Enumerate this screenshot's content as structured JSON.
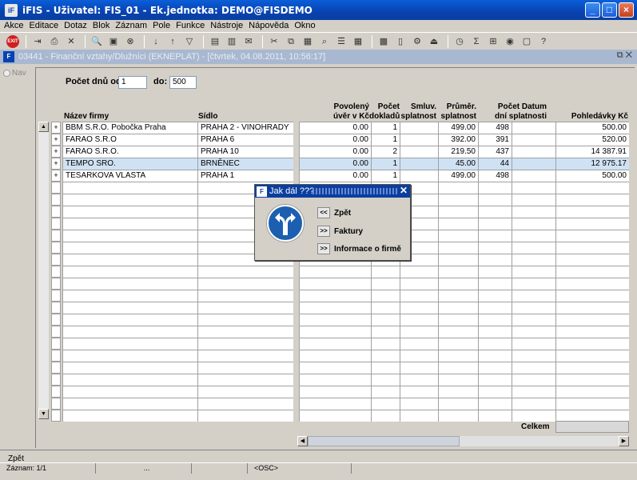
{
  "window": {
    "icon": "ifis-app-icon",
    "title": "iFIS - Uživatel: FIS_01 - Ek.jednotka: DEMO@FISDEMO"
  },
  "menu": [
    "Akce",
    "Editace",
    "Dotaz",
    "Blok",
    "Záznam",
    "Pole",
    "Funkce",
    "Nástroje",
    "Nápověda",
    "Okno"
  ],
  "inner_window": {
    "title": "03441 - Finanční vztahy/Dlužníci (EKNEPLAT) - [čtvrtek, 04.08.2011, 10:56:17]"
  },
  "sidebar": {
    "nav_label": "Nav"
  },
  "filter": {
    "days_from_label": "Počet dnů od:",
    "days_from_value": "1",
    "days_to_label": "do:",
    "days_to_value": "500"
  },
  "columns": {
    "company": "Název firmy",
    "seat": "Sídlo",
    "credit": "Povolený\núvěr v Kč",
    "docs": "Počet\ndokladů",
    "contract": "Smluv.\nsplatnost",
    "avg": "Průměr.\nsplatnost",
    "days": "Počet Datum\ndní splatnosti",
    "receivables": "Pohledávky Kč"
  },
  "rows": [
    {
      "company": "BBM S.R.O. Pobočka Praha",
      "seat": "PRAHA 2 - VINOHRADY",
      "credit": "0.00",
      "docs": "1",
      "contract": "",
      "avg": "499.00",
      "days": "498",
      "due": "",
      "receivables": "500.00"
    },
    {
      "company": "FARAO S.R.O",
      "seat": "PRAHA 6",
      "credit": "0.00",
      "docs": "1",
      "contract": "",
      "avg": "392.00",
      "days": "391",
      "due": "",
      "receivables": "520.00"
    },
    {
      "company": "FARAO S.R.O.",
      "seat": "PRAHA 10",
      "credit": "0.00",
      "docs": "2",
      "contract": "",
      "avg": "219.50",
      "days": "437",
      "due": "",
      "receivables": "14 387.91"
    },
    {
      "company": "TEMPO SRO.",
      "seat": "BRNĚNEC",
      "credit": "0.00",
      "docs": "1",
      "contract": "",
      "avg": "45.00",
      "days": "44",
      "due": "",
      "receivables": "12 975.17"
    },
    {
      "company": "TESARKOVA VLASTA",
      "seat": "PRAHA 1",
      "credit": "0.00",
      "docs": "1",
      "contract": "",
      "avg": "499.00",
      "days": "498",
      "due": "",
      "receivables": "500.00"
    }
  ],
  "total_label": "Celkem",
  "dialog": {
    "title": "Jak dál ???",
    "options": [
      "Zpět",
      "Faktury",
      "Informace o firmě"
    ],
    "buttons": [
      "<<",
      ">>",
      ">>"
    ]
  },
  "status": {
    "message": "Zpět",
    "record": "Záznam: 1/1",
    "seg2": "...",
    "seg3": "<OSC>"
  }
}
